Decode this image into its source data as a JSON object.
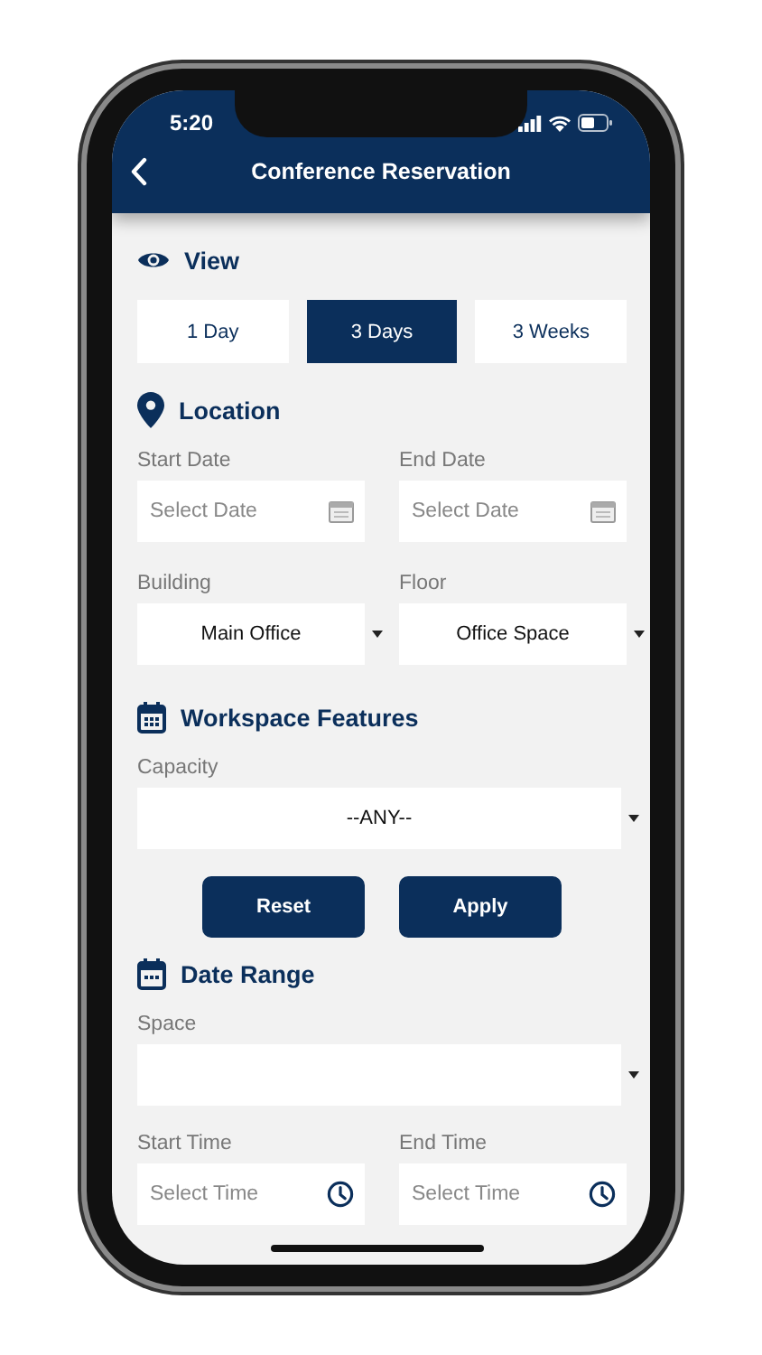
{
  "status_bar": {
    "time": "5:20"
  },
  "header": {
    "title": "Conference Reservation"
  },
  "view": {
    "heading": "View",
    "options": [
      {
        "label": "1 Day",
        "selected": false
      },
      {
        "label": "3 Days",
        "selected": true
      },
      {
        "label": "3 Weeks",
        "selected": false
      }
    ]
  },
  "location": {
    "heading": "Location",
    "dates": [
      {
        "label": "Start Date",
        "placeholder": "Select Date"
      },
      {
        "label": "End Date",
        "placeholder": "Select Date"
      }
    ],
    "selects": [
      {
        "label": "Building",
        "value": "Main Office"
      },
      {
        "label": "Floor",
        "value": "Office Space"
      }
    ]
  },
  "workspace_features": {
    "heading": "Workspace Features",
    "capacity": {
      "label": "Capacity",
      "value": "--ANY--"
    }
  },
  "buttons": [
    "Reset",
    "Apply"
  ],
  "date_range": {
    "heading": "Date Range",
    "space": {
      "label": "Space"
    },
    "times": [
      {
        "label": "Start Time",
        "placeholder": "Select Time"
      },
      {
        "label": "End Time",
        "placeholder": "Select Time"
      }
    ]
  }
}
